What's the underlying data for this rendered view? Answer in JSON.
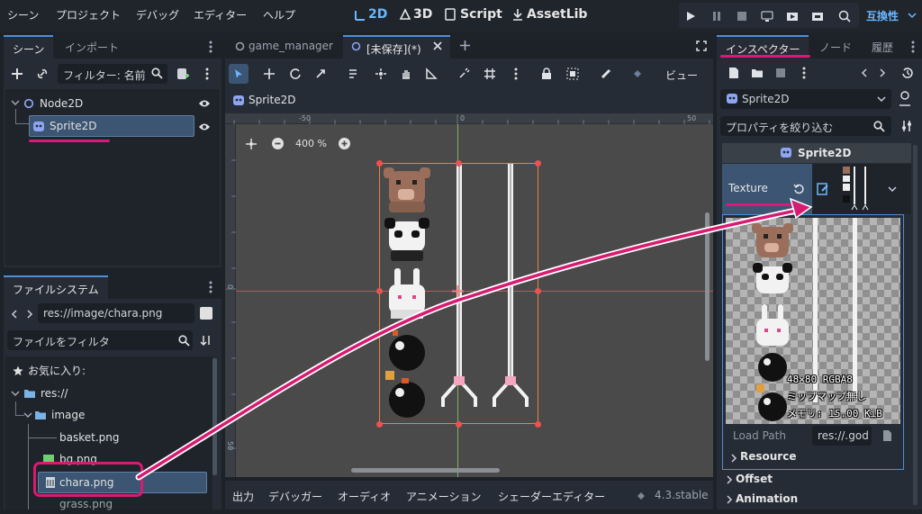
{
  "menu": [
    "シーン",
    "プロジェクト",
    "デバッグ",
    "エディター",
    "ヘルプ"
  ],
  "workspaces": [
    "2D",
    "3D",
    "Script",
    "AssetLib"
  ],
  "renderer": "互換性",
  "scene_panel": {
    "tabs": [
      "シーン",
      "インポート"
    ],
    "filter_placeholder": "フィルター: 名前",
    "tree": [
      {
        "label": "Node2D"
      },
      {
        "label": "Sprite2D"
      }
    ]
  },
  "filesystem": {
    "tab": "ファイルシステム",
    "path": "res://image/chara.png",
    "filter_placeholder": "ファイルをフィルタ",
    "favorites": "お気に入り:",
    "root": "res://",
    "folder": "image",
    "files": [
      "basket.png",
      "bg.png",
      "chara.png",
      "grass.png"
    ]
  },
  "editor_tabs": [
    "game_manager",
    "[未保存](*)"
  ],
  "viewport": {
    "breadcrumb": "Sprite2D",
    "zoom": "400 %",
    "view_label": "ビュー",
    "ruler_labels": [
      "-50",
      "0",
      "50"
    ],
    "vruler_labels": [
      "0",
      "50"
    ]
  },
  "bottom_tabs": [
    "出力",
    "デバッガー",
    "オーディオ",
    "アニメーション",
    "シェーダーエディター"
  ],
  "version": "4.3.stable",
  "inspector": {
    "tabs": [
      "インスペクター",
      "ノード",
      "履歴"
    ],
    "node": "Sprite2D",
    "filter_placeholder": "プロパティを絞り込む",
    "class_header": "Sprite2D",
    "texture_label": "Texture",
    "tooltip": [
      "48×80 RGBA8",
      "ミップマップ無し",
      "メモリ: 15.00 KiB"
    ],
    "load_path_label": "Load Path",
    "load_path_value": "res://.god",
    "sections": [
      "Resource",
      "Offset",
      "Animation"
    ]
  },
  "colors": {
    "accent": "#6ab7ff",
    "highlight": "#e0157a",
    "selection": "#3b5572"
  }
}
